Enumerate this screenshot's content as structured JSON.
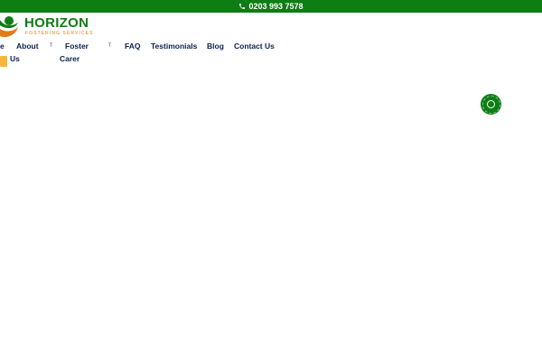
{
  "topbar": {
    "phone": "0203 993 7578",
    "phone_icon": "phone-icon",
    "background": "#0d7d14"
  },
  "logo": {
    "wordmark": "HORIZON",
    "tagline": "FOSTERING SERVICES",
    "mark_icon": "horizon-logo-mark",
    "green": "#0d7d14",
    "orange": "#e07c1a"
  },
  "nav": {
    "home_fragment": "e",
    "about_line1": "About",
    "about_line2": "Us",
    "foster_line1": "Foster",
    "foster_line2": "Carer",
    "faq": "FAQ",
    "testimonials": "Testimonials",
    "blog": "Blog",
    "contact": "Contact Us",
    "dropdown_caret": "ᵀ"
  },
  "floating": {
    "chat_icon": "chat-circle-icon",
    "color": "#0d7d14"
  }
}
